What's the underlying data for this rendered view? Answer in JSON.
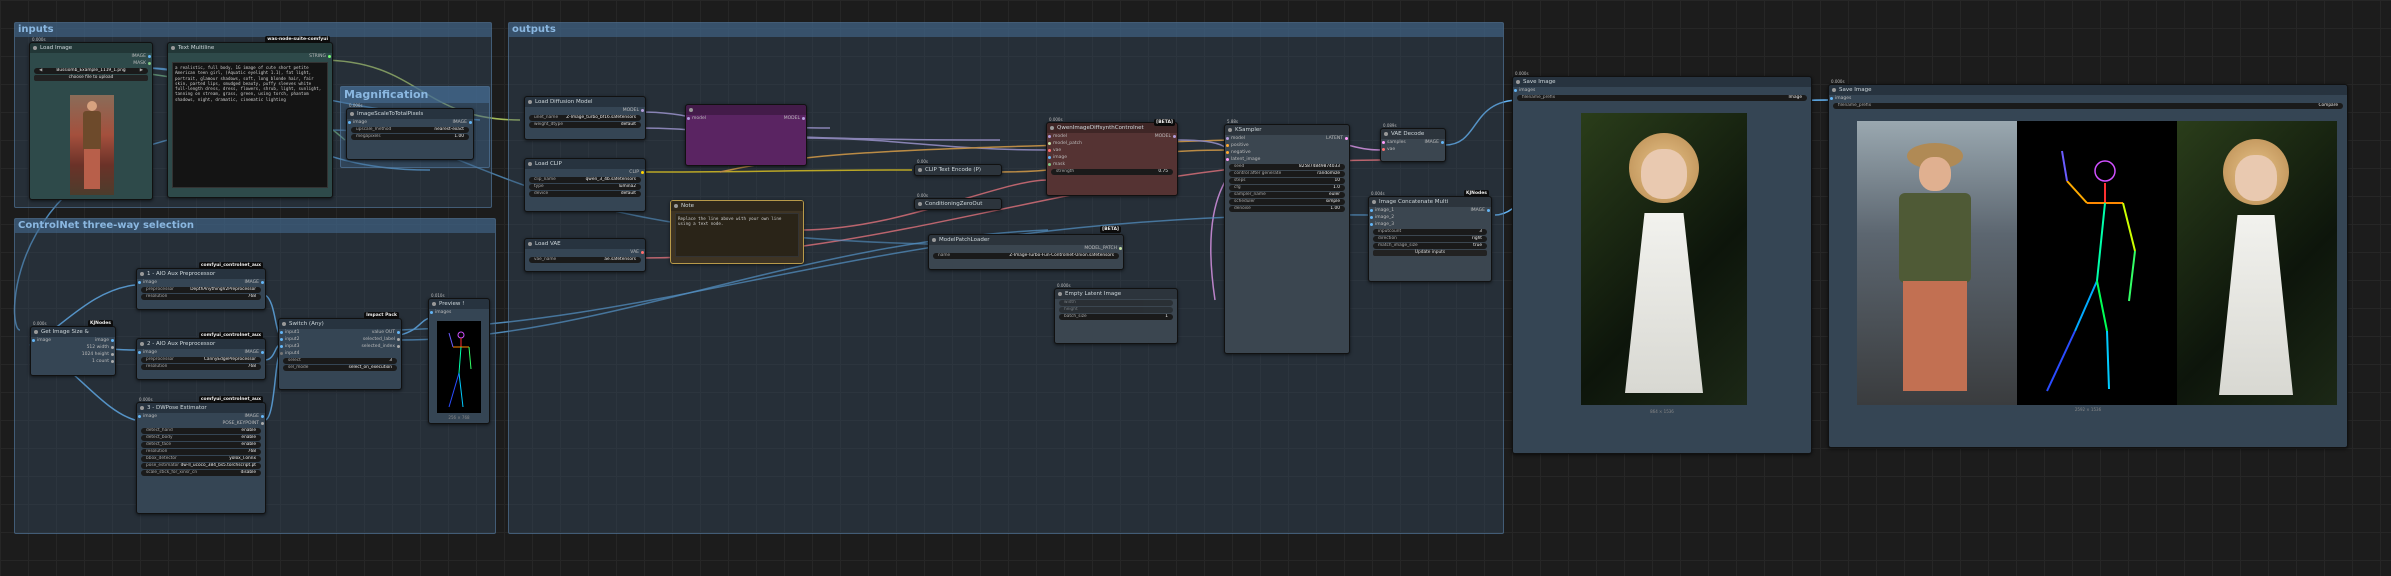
{
  "groups": {
    "inputs": "inputs",
    "outputs": "outputs",
    "controlnet": "ControlNet three-way selection",
    "magnification": "Magnification"
  },
  "nodes": {
    "load_image": {
      "title": "Load Image",
      "time": "0.000s",
      "out_image": "IMAGE",
      "out_mask": "MASK",
      "file": "Bussiomb_Example_1119_1.png",
      "upload": "choose file to upload"
    },
    "text_multiline": {
      "title": "Text Multiline",
      "badge": "was-node-suite-comfyui",
      "out": "STRING",
      "text": "a realistic, full body, 1G image of cute short petite American teen girl, (Aquatic eyelight 1.1), fat light, portrait, glamour shadows, soft, long blonde hair, fair skin, parted lips, smudged beauty, puffy sleeves white full-length dress, dress, flowers, shrub, light, sunlight, tanning on stream, grass, green, using torch, phantom shadows, night, dramatic, cinematic lighting"
    },
    "image_scale": {
      "title": "ImageScaleToTotalPixels",
      "time": "0.000s",
      "in": "image",
      "out": "IMAGE",
      "w1k": "upscale_method",
      "w1v": "nearest-exact",
      "w2k": "megapixels",
      "w2v": "1.00"
    },
    "load_diffusion": {
      "title": "Load Diffusion Model",
      "out": "MODEL",
      "w1k": "unet_name",
      "w1v": "Z-Image_turbo_bf16.safetensors",
      "w2k": "weight_dtype",
      "w2v": "default"
    },
    "load_clip": {
      "title": "Load CLIP",
      "out": "CLIP",
      "w1k": "clip_name",
      "w1v": "qwen_3_4b.safetensors",
      "w2k": "type",
      "w2v": "lumina2",
      "w3k": "device",
      "w3v": "default"
    },
    "load_vae": {
      "title": "Load VAE",
      "out": "VAE",
      "w1k": "vae_name",
      "w1v": "ae.safetensors"
    },
    "note": {
      "title": "Note",
      "text": "Replace the line above with your own line using a text node."
    },
    "purple": {
      "title": "",
      "in": "model",
      "out": "MODEL"
    },
    "clip_encode": {
      "title": "CLIP Text Encode (P)",
      "time": "0.00s"
    },
    "cond_zero": {
      "title": "ConditioningZeroOut",
      "time": "0.00s"
    },
    "qwen_diffsynth": {
      "title": "QwenImageDiffsynthControlnet",
      "badge": "[BETA]",
      "time": "0.000s",
      "ins": [
        "model",
        "model_patch",
        "vae",
        "image",
        "mask"
      ],
      "out": "MODEL",
      "w1k": "strength",
      "w1v": "0.75"
    },
    "patch_loader": {
      "title": "ModelPatchLoader",
      "badge": "[BETA]",
      "out": "MODEL_PATCH",
      "w1k": "name",
      "w1v": "Z-Image-Turbo-Fun-Controlnet-Union.safetensors"
    },
    "empty_latent": {
      "title": "Empty Latent Image",
      "time": "0.000s",
      "w1k": "width",
      "w1v": "",
      "w2k": "height",
      "w2v": "",
      "w3k": "batch_size",
      "w3v": "1"
    },
    "ksampler": {
      "title": "KSampler",
      "time": "5.88s",
      "ins": [
        "model",
        "positive",
        "negative",
        "latent_image"
      ],
      "out": "LATENT",
      "widgets": [
        [
          "seed",
          "825874849874033"
        ],
        [
          "control after generate",
          "randomize"
        ],
        [
          "steps",
          "10"
        ],
        [
          "cfg",
          "1.0"
        ],
        [
          "sampler_name",
          "euler"
        ],
        [
          "scheduler",
          "simple"
        ],
        [
          "denoise",
          "1.00"
        ]
      ]
    },
    "vae_decode": {
      "title": "VAE Decode",
      "time": "0.089s",
      "ins": [
        "samples",
        "vae"
      ],
      "out": "IMAGE"
    },
    "concat": {
      "title": "Image Concatenate Multi",
      "badge": "KJNodes",
      "time": "0.004s",
      "ins": [
        "image_1",
        "image_2",
        "image_3"
      ],
      "out": "IMAGE",
      "widgets": [
        [
          "inputcount",
          "3"
        ],
        [
          "direction",
          "right"
        ],
        [
          "match_image_size",
          "true"
        ]
      ],
      "btn": "Update inputs"
    },
    "save1": {
      "title": "Save Image",
      "time": "0.000s",
      "in": "images",
      "prefix": "filename_prefix",
      "prefix_v": "Image",
      "caption": "864 × 1536"
    },
    "save2": {
      "title": "Save Image",
      "time": "0.000s",
      "in": "images",
      "prefix": "filename_prefix",
      "prefix_v": "Compare",
      "caption": "2592 × 1536"
    },
    "get_size": {
      "title": "Get Image Size &",
      "badge": "KJNodes",
      "time": "0.000s",
      "in": "image",
      "outs": [
        "image",
        "512 width",
        "1024 height",
        "1 count"
      ]
    },
    "aio1": {
      "title": "1 - AIO Aux Preprocessor",
      "badge": "comfyui_controlnet_aux",
      "in": "image",
      "out": "IMAGE",
      "w1k": "preprocessor",
      "w1v": "DepthAnythingV2Preprocessor",
      "w2k": "resolution",
      "w2v": "768"
    },
    "aio2": {
      "title": "2 - AIO Aux Preprocessor",
      "badge": "comfyui_controlnet_aux",
      "in": "image",
      "out": "IMAGE",
      "w1k": "preprocessor",
      "w1v": "CannyEdgePreprocessor",
      "w2k": "resolution",
      "w2v": "768"
    },
    "dwpose": {
      "title": "3 - DWPose Estimator",
      "badge": "comfyui_controlnet_aux",
      "time": "0.000s",
      "in": "image",
      "outs": [
        "IMAGE",
        "POSE_KEYPOINT"
      ],
      "widgets": [
        [
          "detect_hand",
          "enable"
        ],
        [
          "detect_body",
          "enable"
        ],
        [
          "detect_face",
          "enable"
        ],
        [
          "resolution",
          "768"
        ],
        [
          "bbox_detector",
          "yolox_l.onnx"
        ],
        [
          "pose_estimator",
          "dw-ll_ucoco_384_bs5.torchscript.pt"
        ],
        [
          "scale_stick_for_xinsr_cn",
          "disable"
        ]
      ]
    },
    "switch": {
      "title": "Switch (Any)",
      "badge": "Impact Pack",
      "ins": [
        "input1",
        "input2",
        "input3",
        "input4"
      ],
      "outs": [
        "value OUT",
        "selected_label",
        "selected_index"
      ],
      "w1k": "select",
      "w1v": "3",
      "w2k": "sel_mode",
      "w2v": "select_on_execution"
    },
    "preview": {
      "title": "Preview !",
      "time": "0.010s",
      "in": "images",
      "caption": "256 × 768"
    }
  },
  "colors": {
    "model": "#b39ddb",
    "clip": "#ffd500",
    "vae": "#ff6e6e",
    "image": "#64b5f6",
    "latent": "#ff9cf9",
    "cond": "#ffa931",
    "string": "#77ff77",
    "mask": "#81c784"
  }
}
